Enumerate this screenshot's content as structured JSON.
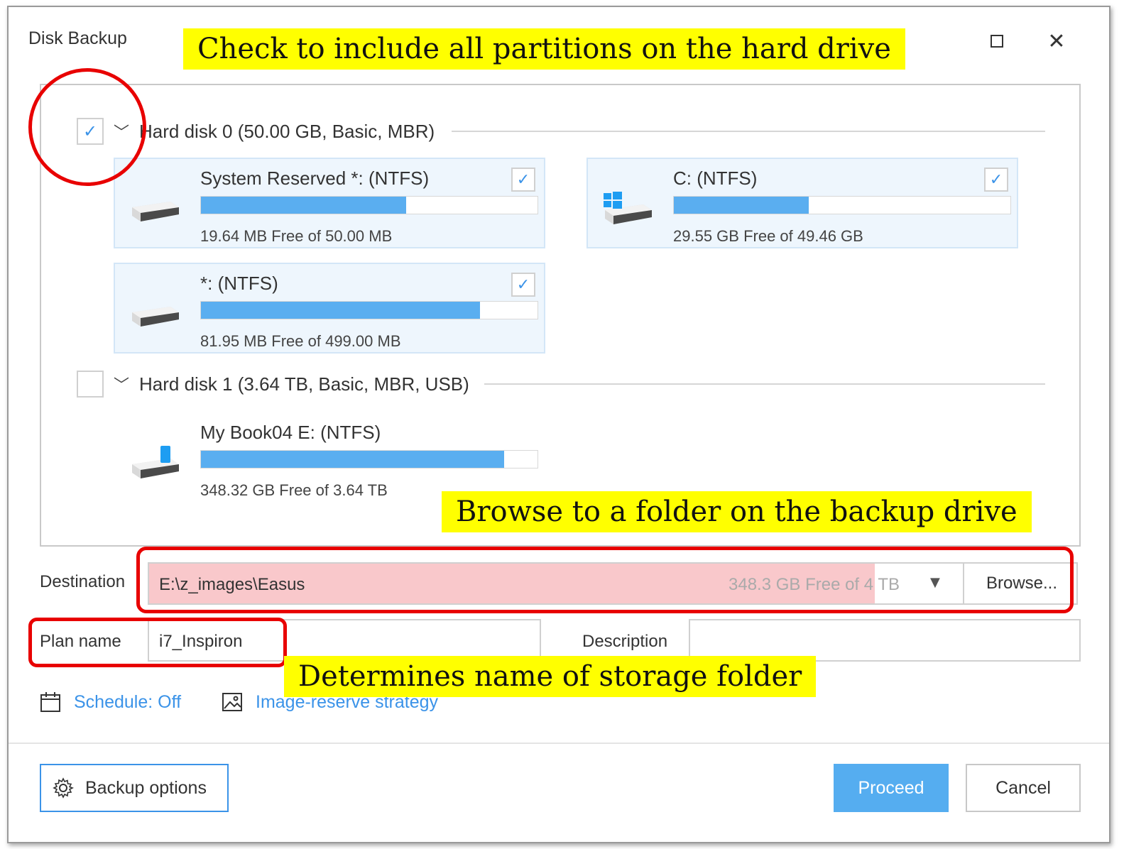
{
  "window": {
    "title": "Disk Backup",
    "close_glyph": "✕"
  },
  "disks": [
    {
      "label": "Hard disk 0 (50.00 GB, Basic, MBR)",
      "checked": true,
      "partitions": [
        {
          "name": "System Reserved *: (NTFS)",
          "free_text": "19.64 MB Free of 50.00 MB",
          "used_fraction": 0.61,
          "checked": true,
          "icon": "drive-icon"
        },
        {
          "name": "C: (NTFS)",
          "free_text": "29.55 GB Free of 49.46 GB",
          "used_fraction": 0.4,
          "checked": true,
          "icon": "windows-drive-icon"
        },
        {
          "name": "*: (NTFS)",
          "free_text": "81.95 MB Free of 499.00 MB",
          "used_fraction": 0.83,
          "checked": true,
          "icon": "drive-icon"
        }
      ]
    },
    {
      "label": "Hard disk 1 (3.64 TB, Basic, MBR, USB)",
      "checked": false,
      "partitions": [
        {
          "name": "My Book04 E: (NTFS)",
          "free_text": "348.32 GB Free of 3.64 TB",
          "used_fraction": 0.9,
          "checked": false,
          "icon": "usb-drive-icon"
        }
      ]
    }
  ],
  "destination": {
    "label": "Destination",
    "path": "E:\\z_images\\Easus",
    "free_text": "348.3 GB Free of 4 TB",
    "browse_label": "Browse..."
  },
  "plan": {
    "label": "Plan name",
    "value": "i7_Inspiron"
  },
  "description": {
    "label": "Description",
    "value": ""
  },
  "links": {
    "schedule": "Schedule: Off",
    "image_reserve": "Image-reserve strategy"
  },
  "buttons": {
    "backup_options": "Backup options",
    "proceed": "Proceed",
    "cancel": "Cancel"
  },
  "annotations": {
    "include_partitions": "Check to include all partitions on the hard drive",
    "browse_folder": "Browse to a folder on the backup drive",
    "storage_folder": "Determines name of storage folder"
  },
  "colors": {
    "accent": "#3b93e8",
    "bar_fill": "#5aaef0",
    "highlight": "#ffff00",
    "ring": "#e80000",
    "dest_fill": "#f9c8cb"
  }
}
